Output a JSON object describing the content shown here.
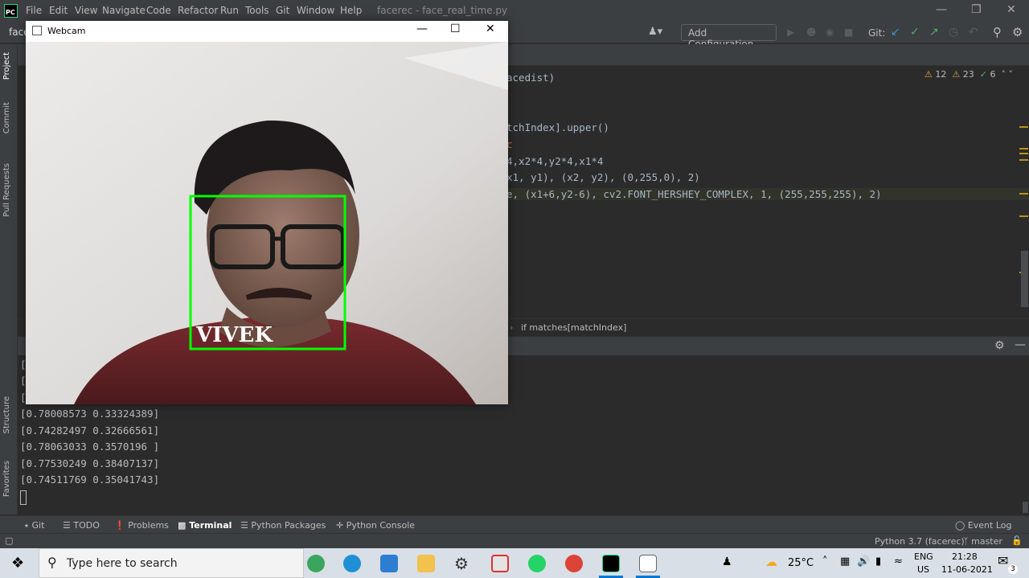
{
  "menubar": {
    "logo": "PC",
    "items": [
      "File",
      "Edit",
      "View",
      "Navigate",
      "Code",
      "Refactor",
      "Run",
      "Tools",
      "Git",
      "Window",
      "Help"
    ],
    "title": "facerec - face_real_time.py"
  },
  "toolbar": {
    "project": "face",
    "add_config": "Add Configuration...",
    "git_label": "Git:"
  },
  "left_strip": [
    "Project",
    "Commit",
    "Pull Requests",
    "Structure",
    "Favorites"
  ],
  "inspections": {
    "warnings": "12",
    "weak": "23",
    "ok": "6"
  },
  "code_lines": [
    {
      "text": "acedist)"
    },
    {
      "text": ""
    },
    {
      "text": "tchIndex].upper()"
    },
    {
      "text": "c"
    },
    {
      "text": "4,x2*4,y2*4,x1*4"
    },
    {
      "text": "x1, y1), (x2, y2), (0,255,0), 2)"
    },
    {
      "text": "e, (x1+6,y2-6), cv2.FONT_HERSHEY_COMPLEX, 1, (255,255,255), 2)"
    }
  ],
  "breadcrumb": "if matches[matchIndex]",
  "terminal": {
    "lines": [
      "[0.78008573 0.33324389]",
      "[0.74282497 0.32666561]",
      "[0.78063033 0.3570196 ]",
      "[0.77530249 0.38407137]",
      "[0.74511769 0.35041743]"
    ],
    "partial": [
      "[",
      "[",
      "["
    ]
  },
  "tool_tabs": [
    "Git",
    "TODO",
    "Problems",
    "Terminal",
    "Python Packages",
    "Python Console"
  ],
  "active_tool_tab": "Terminal",
  "event_log": "Event Log",
  "status": {
    "interpreter": "Python 3.7 (facerec)",
    "branch": "master"
  },
  "webcam": {
    "title": "Webcam",
    "name_label": "VIVEK",
    "box_color": "#00ff00"
  },
  "taskbar": {
    "search_placeholder": "Type here to search",
    "temperature": "25°C",
    "lang_top": "ENG",
    "lang_bottom": "US",
    "time": "21:28",
    "date": "11-06-2021",
    "notifications": "3"
  }
}
